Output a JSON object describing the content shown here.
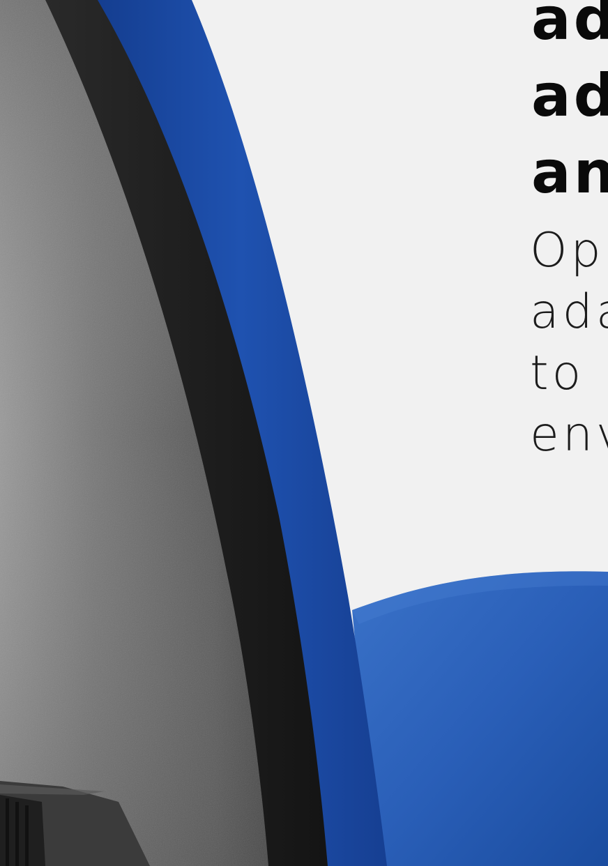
{
  "headline_lines": [
    "ad",
    "ad",
    "an"
  ],
  "subline_lines": [
    "Op",
    "ada",
    "to",
    "env"
  ],
  "colors": {
    "background": "#f1f1f1",
    "chair_blue": "#1d4fa8",
    "chair_shell_grey": "#6f6f6f",
    "chair_edge_dark": "#1e1e1e"
  }
}
